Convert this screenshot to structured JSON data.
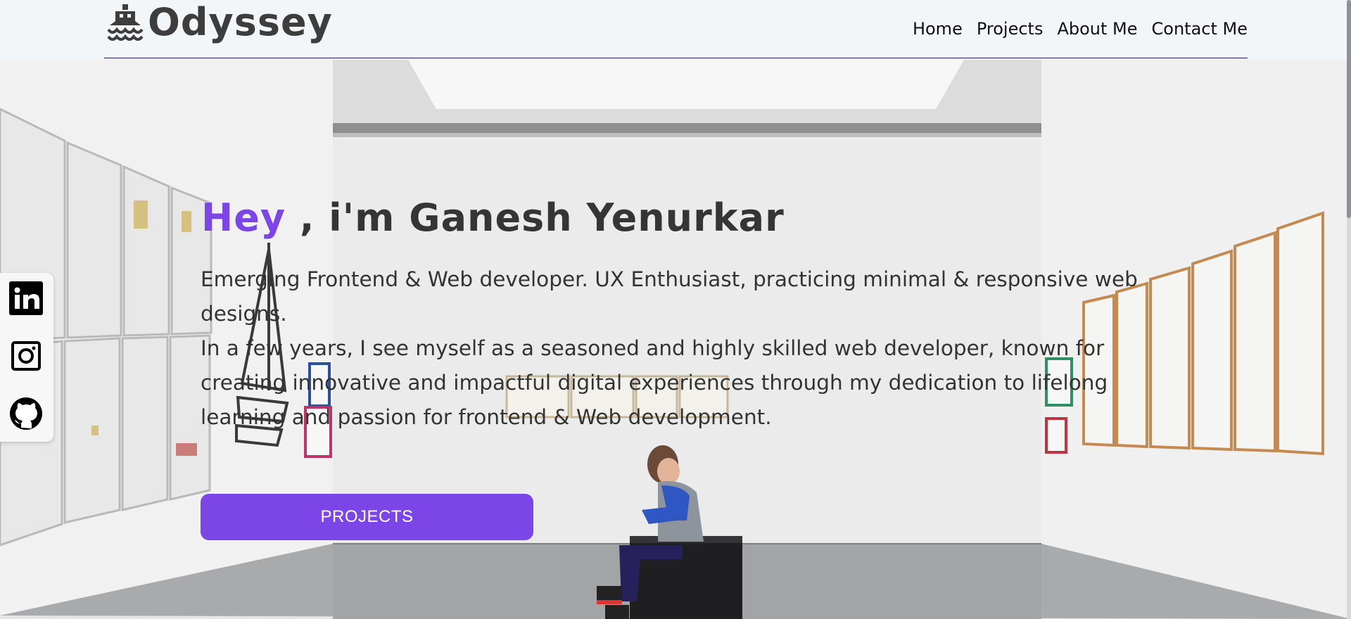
{
  "brand": {
    "name": "Odyssey",
    "icon": "ship-icon"
  },
  "nav": {
    "items": [
      {
        "label": "Home"
      },
      {
        "label": "Projects"
      },
      {
        "label": "About Me"
      },
      {
        "label": "Contact Me"
      }
    ]
  },
  "hero": {
    "greeting_accent": "Hey",
    "greeting_rest": " , i'm Ganesh Yenurkar",
    "description_line1": "Emerging Frontend & Web developer. UX Enthusiast, practicing minimal & responsive web designs.",
    "description_line2": "In a few years, I see myself as a seasoned and highly skilled web developer, known for creating innovative and impactful digital experiences through my dedication to lifelong learning and passion for frontend & Web development.",
    "cta_label": "PROJECTS",
    "background": "gallery-photo-child-on-bench"
  },
  "social": {
    "items": [
      {
        "icon": "linkedin-icon"
      },
      {
        "icon": "instagram-icon"
      },
      {
        "icon": "github-icon"
      }
    ]
  },
  "colors": {
    "accent": "#7b45e7",
    "header_bg": "#f2f6f9",
    "header_rule": "#1a1f6e",
    "text": "#333333"
  }
}
